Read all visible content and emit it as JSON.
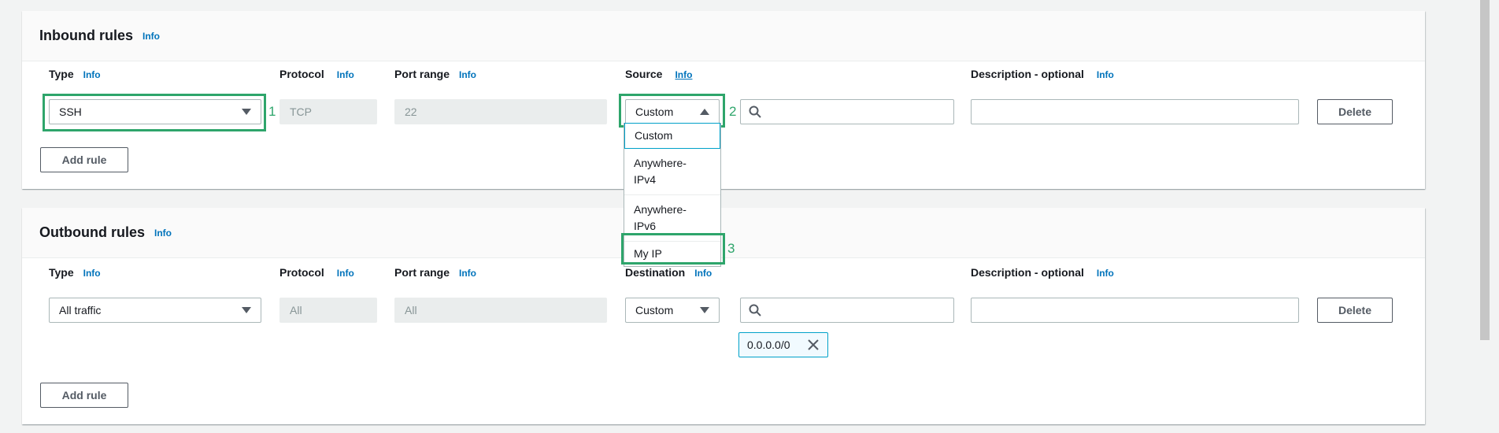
{
  "inbound": {
    "title": "Inbound rules",
    "title_info": "Info",
    "columns": {
      "type": "Type",
      "type_info": "Info",
      "protocol": "Protocol",
      "protocol_info": "Info",
      "port_range": "Port range",
      "port_range_info": "Info",
      "source": "Source",
      "source_info": "Info",
      "description": "Description - optional",
      "description_info": "Info"
    },
    "row": {
      "type": "SSH",
      "protocol": "TCP",
      "port_range": "22",
      "source": "Custom",
      "search_value": "",
      "description_value": "",
      "delete_label": "Delete"
    },
    "source_options": [
      "Custom",
      "Anywhere-\nIPv4",
      "Anywhere-\nIPv6",
      "My IP"
    ],
    "add_rule_label": "Add rule"
  },
  "outbound": {
    "title": "Outbound rules",
    "title_info": "Info",
    "columns": {
      "type": "Type",
      "type_info": "Info",
      "protocol": "Protocol",
      "protocol_info": "Info",
      "port_range": "Port range",
      "port_range_info": "Info",
      "destination": "Destination",
      "destination_info": "Info",
      "description": "Description - optional",
      "description_info": "Info"
    },
    "row": {
      "type": "All traffic",
      "protocol": "All",
      "port_range": "All",
      "destination": "Custom",
      "search_value": "",
      "description_value": "",
      "delete_label": "Delete",
      "cidr_token": "0.0.0.0/0"
    },
    "add_rule_label": "Add rule"
  },
  "annotations": {
    "one": "1",
    "two": "2",
    "three": "3"
  },
  "icons": {
    "search": "search-icon",
    "close": "close-icon",
    "caret_down": "caret-down-icon",
    "caret_up": "caret-up-icon"
  },
  "colors": {
    "highlight": "#2ea56b",
    "link": "#0073bb",
    "token_border": "#00a1c9"
  }
}
